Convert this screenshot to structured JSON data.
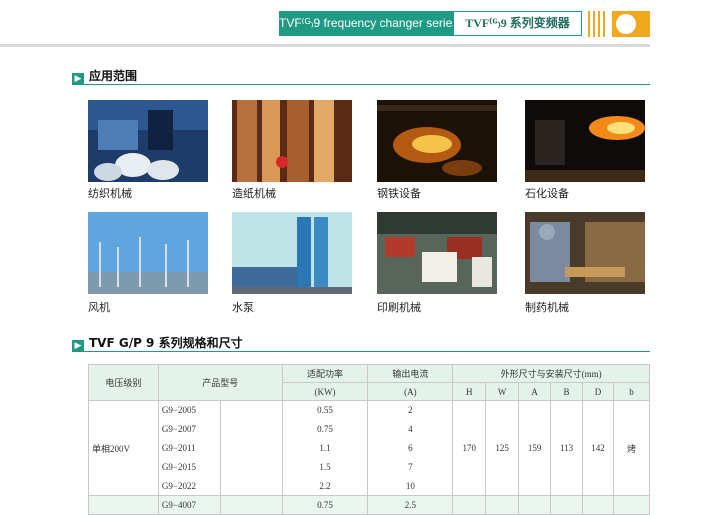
{
  "header": {
    "series_en": "TVF⁽ᴳ₎9 frequency changer series",
    "series_cn": "TVF⁽ᴳ₎9 系列变频器"
  },
  "sections": {
    "applications_title": "应用范围",
    "spec_title": "TVF G/P 9 系列规格和尺寸"
  },
  "applications": [
    {
      "label": "纺织机械",
      "icon": "textile-machine-photo"
    },
    {
      "label": "造纸机械",
      "icon": "paper-machine-photo"
    },
    {
      "label": "钢铁设备",
      "icon": "steel-equipment-photo"
    },
    {
      "label": "石化设备",
      "icon": "petrochemical-photo"
    },
    {
      "label": "风机",
      "icon": "wind-turbine-photo"
    },
    {
      "label": "水泵",
      "icon": "water-pump-photo"
    },
    {
      "label": "印刷机械",
      "icon": "printing-machine-photo"
    },
    {
      "label": "制药机械",
      "icon": "pharma-machine-photo"
    }
  ],
  "table": {
    "headers": {
      "voltage": "电压级别",
      "model": "产品型号",
      "power": "适配功率",
      "power_unit": "(KW)",
      "current": "输出电流",
      "current_unit": "(A)",
      "dims": "外形尺寸与安装尺寸(mm)",
      "h": "H",
      "w": "W",
      "a": "A",
      "b": "B",
      "d": "D",
      "bb": "b"
    },
    "group": {
      "voltage": "单相200V",
      "H": "170",
      "W": "125",
      "A": "159",
      "B": "113",
      "D": "142",
      "b": "烤"
    },
    "rows": [
      {
        "model": "G9−2005",
        "power": "0.55",
        "current": "2"
      },
      {
        "model": "G9−2007",
        "power": "0.75",
        "current": "4"
      },
      {
        "model": "G9−2011",
        "power": "1.1",
        "current": "6"
      },
      {
        "model": "G9−2015",
        "power": "1.5",
        "current": "7"
      },
      {
        "model": "G9−2022",
        "power": "2.2",
        "current": "10"
      },
      {
        "model": "G9−4007",
        "power": "0.75",
        "current": "2.5"
      }
    ]
  }
}
